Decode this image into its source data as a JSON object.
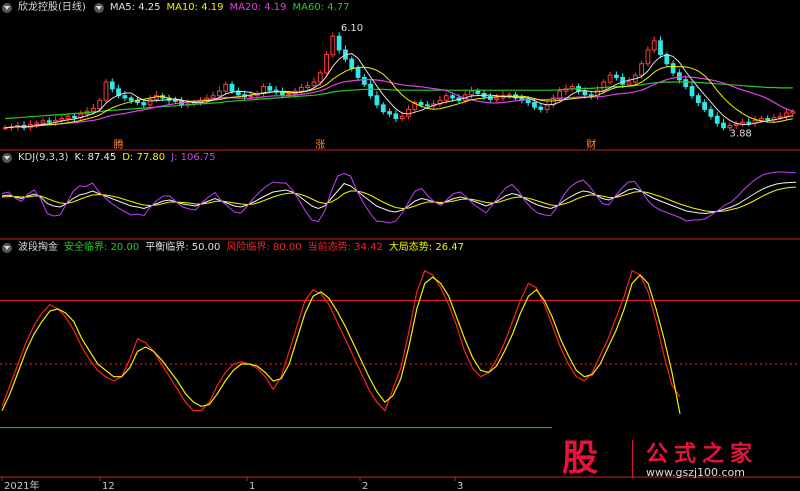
{
  "colors": {
    "bg": "#000000",
    "up": "#ff3b3b",
    "down": "#33e6e6",
    "ma5": "#e0e0e0",
    "ma10": "#f2f200",
    "ma20": "#e040e0",
    "ma60": "#22cc22",
    "kdj_k": "#f0f0f0",
    "kdj_d": "#f2f200",
    "kdj_j": "#c040ff",
    "panel_border": "#c0232e",
    "red_line": "#ff2020",
    "yellow_line": "#f2f200",
    "green_line": "#22cc22",
    "text_gray": "#c8c8c8"
  },
  "panels": {
    "price": {
      "title": "欣龙控股(日线)",
      "ma5_label": "MA5:",
      "ma5_value": "4.25",
      "ma10_label": "MA10:",
      "ma10_value": "4.19",
      "ma20_label": "MA20:",
      "ma20_value": "4.19",
      "ma60_label": "MA60:",
      "ma60_value": "4.77",
      "high_marker": "6.10",
      "low_marker": "3.88",
      "event_labels": [
        "腾",
        "涨",
        "财"
      ]
    },
    "kdj": {
      "title": "KDJ(9,3,3)",
      "k_label": "K:",
      "k_value": "87.45",
      "d_label": "D:",
      "d_value": "77.80",
      "j_label": "J:",
      "j_value": "106.75"
    },
    "wave": {
      "title": "波段掏金",
      "safe_label": "安全临界:",
      "safe_value": "20.00",
      "balance_label": "平衡临界:",
      "balance_value": "50.00",
      "risk_label": "风险临界:",
      "risk_value": "80.00",
      "current_label": "当前态势:",
      "current_value": "34.42",
      "overall_label": "大局态势:",
      "overall_value": "26.47"
    }
  },
  "time_axis": {
    "labels": [
      "2021年",
      "12",
      "1",
      "2",
      "3"
    ]
  },
  "watermark": {
    "logo": "股",
    "name": "公式之家",
    "url": "www.gszj100.com"
  },
  "chart_data": [
    {
      "type": "candlestick",
      "title": "欣龙控股(日线)",
      "ylim": [
        3.5,
        6.3
      ],
      "series": [
        {
          "name": "MA5",
          "value": 4.25
        },
        {
          "name": "MA10",
          "value": 4.19
        },
        {
          "name": "MA20",
          "value": 4.19
        },
        {
          "name": "MA60",
          "value": 4.77
        }
      ],
      "annotations": [
        {
          "text": "6.10",
          "price": 6.1
        },
        {
          "text": "3.88",
          "price": 3.88
        }
      ],
      "close": [
        3.9,
        3.92,
        3.95,
        3.9,
        3.97,
        4.0,
        4.05,
        4.02,
        4.06,
        4.1,
        4.15,
        4.12,
        4.2,
        4.26,
        4.32,
        4.5,
        4.9,
        4.75,
        4.6,
        4.55,
        4.5,
        4.45,
        4.4,
        4.52,
        4.6,
        4.55,
        4.5,
        4.48,
        4.4,
        4.42,
        4.45,
        4.5,
        4.55,
        4.6,
        4.7,
        4.85,
        4.7,
        4.62,
        4.58,
        4.6,
        4.65,
        4.8,
        4.72,
        4.68,
        4.62,
        4.64,
        4.7,
        4.78,
        4.82,
        4.9,
        5.1,
        5.5,
        5.9,
        5.6,
        5.4,
        5.2,
        5.0,
        4.85,
        4.6,
        4.4,
        4.25,
        4.2,
        4.1,
        4.15,
        4.3,
        4.45,
        4.4,
        4.38,
        4.42,
        4.5,
        4.6,
        4.55,
        4.5,
        4.62,
        4.7,
        4.65,
        4.58,
        4.52,
        4.55,
        4.6,
        4.62,
        4.55,
        4.5,
        4.45,
        4.35,
        4.3,
        4.4,
        4.55,
        4.7,
        4.75,
        4.8,
        4.7,
        4.62,
        4.58,
        4.72,
        4.9,
        5.05,
        5.0,
        4.85,
        4.9,
        5.05,
        5.3,
        5.6,
        5.8,
        5.5,
        5.3,
        5.1,
        4.95,
        4.8,
        4.6,
        4.45,
        4.3,
        4.15,
        4.0,
        3.9,
        3.95,
        3.98,
        4.02,
        4.0,
        4.06,
        4.1,
        4.08,
        4.12,
        4.15,
        4.22,
        4.25
      ],
      "ma60": [
        4.1,
        4.11,
        4.12,
        4.13,
        4.14,
        4.15,
        4.16,
        4.17,
        4.18,
        4.19,
        4.2,
        4.21,
        4.22,
        4.23,
        4.24,
        4.25,
        4.27,
        4.28,
        4.29,
        4.3,
        4.31,
        4.32,
        4.33,
        4.34,
        4.35,
        4.36,
        4.37,
        4.38,
        4.39,
        4.4,
        4.41,
        4.42,
        4.43,
        4.44,
        4.45,
        4.47,
        4.48,
        4.49,
        4.5,
        4.51,
        4.52,
        4.53,
        4.54,
        4.55,
        4.56,
        4.57,
        4.58,
        4.59,
        4.6,
        4.61,
        4.63,
        4.65,
        4.68,
        4.7,
        4.71,
        4.72,
        4.73,
        4.74,
        4.74,
        4.74,
        4.74,
        4.73,
        4.72,
        4.72,
        4.72,
        4.72,
        4.72,
        4.72,
        4.72,
        4.72,
        4.72,
        4.72,
        4.72,
        4.72,
        4.72,
        4.72,
        4.72,
        4.72,
        4.72,
        4.72,
        4.72,
        4.72,
        4.72,
        4.72,
        4.72,
        4.72,
        4.72,
        4.72,
        4.73,
        4.74,
        4.75,
        4.75,
        4.76,
        4.76,
        4.77,
        4.78,
        4.79,
        4.8,
        4.8,
        4.81,
        4.82,
        4.84,
        4.86,
        4.88,
        4.89,
        4.9,
        4.9,
        4.9,
        4.9,
        4.9,
        4.89,
        4.88,
        4.87,
        4.86,
        4.85,
        4.84,
        4.83,
        4.82,
        4.81,
        4.8,
        4.79,
        4.78,
        4.78,
        4.77,
        4.77,
        4.77
      ]
    },
    {
      "type": "line",
      "title": "KDJ(9,3,3)",
      "ylim": [
        -20,
        120
      ],
      "series": [
        {
          "name": "K",
          "final": 87.45,
          "values": [
            60,
            62,
            58,
            55,
            60,
            64,
            58,
            45,
            40,
            38,
            45,
            55,
            62,
            65,
            70,
            65,
            60,
            55,
            50,
            45,
            40,
            38,
            35,
            40,
            45,
            50,
            52,
            48,
            44,
            42,
            40,
            45,
            50,
            55,
            50,
            45,
            40,
            38,
            42,
            48,
            55,
            62,
            68,
            70,
            72,
            68,
            60,
            50,
            40,
            35,
            40,
            55,
            70,
            85,
            80,
            70,
            60,
            50,
            40,
            35,
            30,
            28,
            32,
            40,
            50,
            55,
            52,
            48,
            45,
            50,
            55,
            58,
            55,
            50,
            45,
            40,
            45,
            52,
            60,
            65,
            62,
            55,
            48,
            42,
            38,
            35,
            40,
            50,
            58,
            65,
            70,
            68,
            62,
            55,
            52,
            58,
            65,
            72,
            75,
            70,
            62,
            55,
            50,
            45,
            40,
            35,
            30,
            28,
            26,
            25,
            27,
            30,
            34,
            38,
            44,
            52,
            60,
            68,
            75,
            80,
            84,
            86,
            87,
            87.45
          ]
        },
        {
          "name": "D",
          "final": 77.8,
          "values": [
            58,
            59,
            59,
            58,
            58,
            60,
            60,
            55,
            50,
            46,
            45,
            48,
            53,
            58,
            62,
            63,
            62,
            60,
            57,
            53,
            49,
            45,
            42,
            41,
            42,
            45,
            48,
            48,
            47,
            46,
            44,
            44,
            46,
            49,
            50,
            48,
            46,
            44,
            43,
            44,
            48,
            53,
            58,
            62,
            65,
            66,
            64,
            60,
            54,
            48,
            45,
            48,
            55,
            65,
            70,
            70,
            67,
            62,
            55,
            48,
            42,
            37,
            35,
            36,
            40,
            45,
            48,
            48,
            47,
            48,
            50,
            53,
            54,
            53,
            50,
            47,
            46,
            48,
            52,
            56,
            58,
            57,
            54,
            50,
            46,
            42,
            41,
            44,
            48,
            54,
            59,
            62,
            62,
            60,
            57,
            57,
            60,
            64,
            68,
            69,
            67,
            63,
            59,
            54,
            49,
            44,
            40,
            36,
            33,
            30,
            29,
            29,
            30,
            33,
            36,
            41,
            47,
            54,
            61,
            67,
            72,
            75,
            77,
            77.8
          ]
        },
        {
          "name": "J",
          "final": 106.75,
          "values": [
            65,
            68,
            56,
            49,
            64,
            72,
            54,
            25,
            20,
            22,
            45,
            69,
            80,
            79,
            86,
            69,
            56,
            45,
            36,
            29,
            22,
            24,
            21,
            38,
            51,
            60,
            60,
            48,
            38,
            34,
            32,
            47,
            58,
            67,
            50,
            39,
            28,
            26,
            40,
            56,
            69,
            80,
            88,
            86,
            86,
            72,
            52,
            30,
            12,
            9,
            30,
            69,
            100,
            105,
            100,
            70,
            46,
            26,
            10,
            9,
            6,
            10,
            26,
            48,
            70,
            75,
            60,
            48,
            41,
            54,
            65,
            68,
            57,
            44,
            35,
            26,
            43,
            60,
            76,
            83,
            70,
            51,
            36,
            26,
            22,
            21,
            38,
            62,
            78,
            87,
            92,
            80,
            62,
            45,
            42,
            60,
            75,
            88,
            89,
            72,
            52,
            39,
            32,
            27,
            22,
            17,
            10,
            12,
            12,
            15,
            23,
            32,
            42,
            48,
            60,
            74,
            86,
            96,
            103,
            106,
            108,
            108,
            107,
            106.75
          ]
        }
      ]
    },
    {
      "type": "line",
      "title": "波段掏金",
      "ylim": [
        0,
        100
      ],
      "thresholds": {
        "安全临界": 20.0,
        "平衡临界": 50.0,
        "风险临界": 80.0
      },
      "series": [
        {
          "name": "当前态势",
          "final": 34.42,
          "values": [
            30,
            40,
            50,
            60,
            68,
            74,
            78,
            76,
            72,
            66,
            58,
            52,
            47,
            44,
            42,
            44,
            52,
            62,
            60,
            56,
            50,
            44,
            38,
            32,
            28,
            28,
            32,
            40,
            46,
            50,
            51,
            50,
            48,
            44,
            38,
            44,
            56,
            68,
            80,
            85,
            83,
            78,
            70,
            62,
            54,
            46,
            38,
            32,
            28,
            38,
            48,
            65,
            84,
            94,
            92,
            86,
            78,
            68,
            56,
            48,
            44,
            46,
            52,
            60,
            70,
            80,
            88,
            86,
            78,
            68,
            58,
            50,
            44,
            42,
            46,
            54,
            62,
            72,
            82,
            94,
            92,
            84,
            70,
            54,
            40,
            34.42
          ]
        },
        {
          "name": "大局态势",
          "final": 26.47,
          "values": [
            28,
            36,
            46,
            56,
            64,
            70,
            75,
            76,
            74,
            70,
            62,
            56,
            50,
            47,
            44,
            44,
            48,
            56,
            58,
            56,
            52,
            47,
            42,
            36,
            32,
            30,
            31,
            36,
            42,
            47,
            50,
            50,
            49,
            46,
            42,
            43,
            50,
            62,
            74,
            82,
            84,
            81,
            75,
            68,
            60,
            52,
            44,
            37,
            32,
            35,
            43,
            58,
            76,
            88,
            91,
            88,
            82,
            72,
            62,
            53,
            47,
            46,
            49,
            56,
            64,
            74,
            82,
            85,
            80,
            72,
            62,
            54,
            47,
            44,
            45,
            50,
            58,
            66,
            76,
            88,
            92,
            88,
            76,
            62,
            46,
            26.47
          ]
        }
      ]
    }
  ]
}
